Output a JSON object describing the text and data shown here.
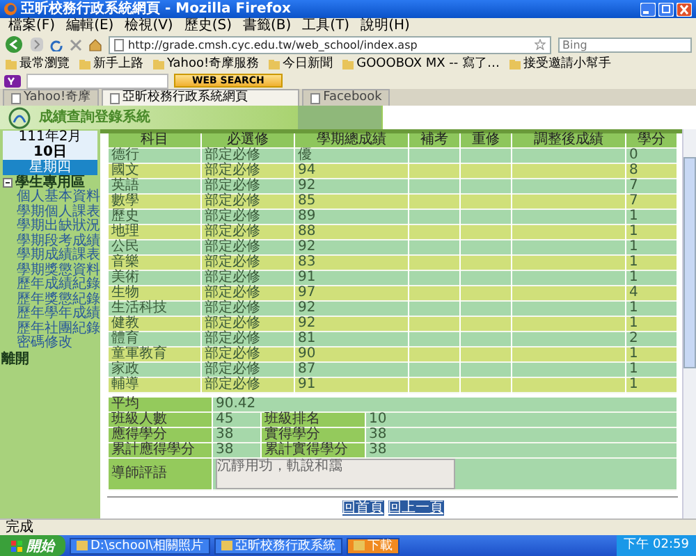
{
  "window": {
    "title": "亞昕校務行政系統網頁 - Mozilla Firefox"
  },
  "menu": [
    "檔案(F)",
    "編輯(E)",
    "檢視(V)",
    "歷史(S)",
    "書籤(B)",
    "工具(T)",
    "說明(H)"
  ],
  "address_bar": {
    "url": "http://grade.cmsh.cyc.edu.tw/web_school/index.asp"
  },
  "search": {
    "placeholder": "Bing"
  },
  "bookmarks": [
    "最常瀏覽",
    "新手上路",
    "Yahoo!奇摩服務",
    "今日新聞",
    "GOOOBOX MX -- 寫了…",
    "接受邀請小幫手"
  ],
  "toolbar": {
    "button": "WEB SEARCH"
  },
  "tabs": [
    {
      "label": "Yahoo!奇摩",
      "selected": false
    },
    {
      "label": "亞昕校務行政系統網頁",
      "selected": true
    },
    {
      "label": "Facebook",
      "selected": false
    }
  ],
  "banner": {
    "title": "成績查詢登錄系統"
  },
  "sidebar": {
    "date": {
      "month": "111年2月",
      "day": "10日",
      "weekday": "星期四"
    },
    "section": {
      "label": "學生專用區",
      "expanded": true,
      "children": [
        {
          "label": "個人基本資料"
        },
        {
          "label": "學期個人課表"
        },
        {
          "label": "學期出缺狀況"
        },
        {
          "label": "學期段考成績"
        },
        {
          "label": "學期成績課表"
        },
        {
          "label": "學期獎懲資料"
        },
        {
          "label": "歷年成績紀錄"
        },
        {
          "label": "歷年獎懲紀錄"
        },
        {
          "label": "歷年學年成績"
        },
        {
          "label": "歷年社團紀錄"
        },
        {
          "label": "密碼修改"
        }
      ]
    },
    "exit": "離開"
  },
  "grades": {
    "columns": [
      "科目",
      "必選修",
      "學期總成績",
      "補考",
      "重修",
      "調整後成績",
      "學分"
    ],
    "rows": [
      {
        "subject": "德行",
        "type": "部定必修",
        "score": "優",
        "credits": "0"
      },
      {
        "subject": "國文",
        "type": "部定必修",
        "score": "94",
        "credits": "8"
      },
      {
        "subject": "英語",
        "type": "部定必修",
        "score": "92",
        "credits": "7"
      },
      {
        "subject": "數學",
        "type": "部定必修",
        "score": "85",
        "credits": "7"
      },
      {
        "subject": "歷史",
        "type": "部定必修",
        "score": "89",
        "credits": "1"
      },
      {
        "subject": "地理",
        "type": "部定必修",
        "score": "88",
        "credits": "1"
      },
      {
        "subject": "公民",
        "type": "部定必修",
        "score": "92",
        "credits": "1"
      },
      {
        "subject": "音樂",
        "type": "部定必修",
        "score": "83",
        "credits": "1"
      },
      {
        "subject": "美術",
        "type": "部定必修",
        "score": "91",
        "credits": "1"
      },
      {
        "subject": "生物",
        "type": "部定必修",
        "score": "97",
        "credits": "4"
      },
      {
        "subject": "生活科技",
        "type": "部定必修",
        "score": "92",
        "credits": "1"
      },
      {
        "subject": "健教",
        "type": "部定必修",
        "score": "92",
        "credits": "1"
      },
      {
        "subject": "體育",
        "type": "部定必修",
        "score": "81",
        "credits": "2"
      },
      {
        "subject": "童軍教育",
        "type": "部定必修",
        "score": "90",
        "credits": "1"
      },
      {
        "subject": "家政",
        "type": "部定必修",
        "score": "87",
        "credits": "1"
      },
      {
        "subject": "輔導",
        "type": "部定必修",
        "score": "91",
        "credits": "1"
      }
    ]
  },
  "summary": {
    "average": {
      "label": "平均",
      "value": "90.42"
    },
    "pairs": [
      [
        {
          "label": "班級人數",
          "value": "45"
        },
        {
          "label": "班級排名",
          "value": "10"
        }
      ],
      [
        {
          "label": "應得學分",
          "value": "38"
        },
        {
          "label": "實得學分",
          "value": "38"
        }
      ],
      [
        {
          "label": "累計應得學分",
          "value": "38"
        },
        {
          "label": "累計實得學分",
          "value": "38"
        }
      ]
    ],
    "comment": {
      "label": "導師評語",
      "value": "沉靜用功，軌說和靄"
    }
  },
  "links": [
    "回首頁",
    "回上一頁"
  ],
  "status_bar": {
    "text": "完成"
  },
  "taskbar": {
    "start": "開始",
    "tasks": [
      {
        "label": "D:\\school\\相關照片",
        "flashing": false
      },
      {
        "label": "亞昕校務行政系統",
        "flashing": false
      },
      {
        "label": "下載",
        "flashing": true
      }
    ],
    "clock": "下午 02:59"
  }
}
